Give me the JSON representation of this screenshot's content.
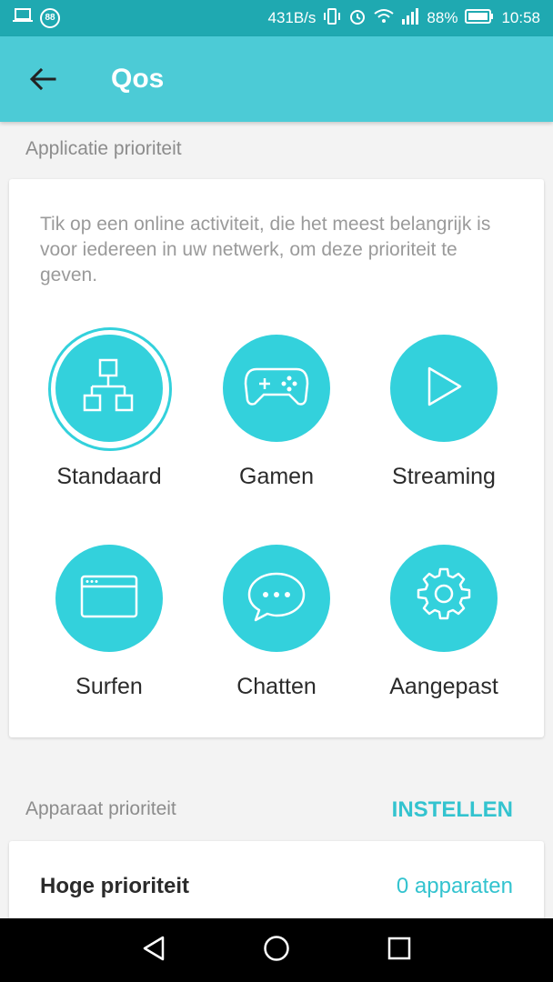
{
  "status_bar": {
    "notification_badge": "88",
    "net_speed": "431B/s",
    "battery_percent": "88%",
    "time": "10:58"
  },
  "app_bar": {
    "title": "Qos"
  },
  "app_priority": {
    "section_label": "Applicatie prioriteit",
    "description": "Tik op een online activiteit, die het meest belangrijk is voor iedereen in uw netwerk, om deze prioriteit te geven.",
    "options": [
      {
        "label": "Standaard",
        "icon": "network-topology-icon",
        "selected": true
      },
      {
        "label": "Gamen",
        "icon": "gamepad-icon",
        "selected": false
      },
      {
        "label": "Streaming",
        "icon": "play-icon",
        "selected": false
      },
      {
        "label": "Surfen",
        "icon": "browser-window-icon",
        "selected": false
      },
      {
        "label": "Chatten",
        "icon": "chat-bubble-icon",
        "selected": false
      },
      {
        "label": "Aangepast",
        "icon": "gear-icon",
        "selected": false
      }
    ]
  },
  "device_priority": {
    "section_label": "Apparaat prioriteit",
    "action_label": "INSTELLEN",
    "row_label": "Hoge prioriteit",
    "row_value": "0 apparaten"
  },
  "colors": {
    "accent": "#33d1dc",
    "app_bar": "#4ccbd6",
    "status_bar": "#1fa9b1"
  }
}
